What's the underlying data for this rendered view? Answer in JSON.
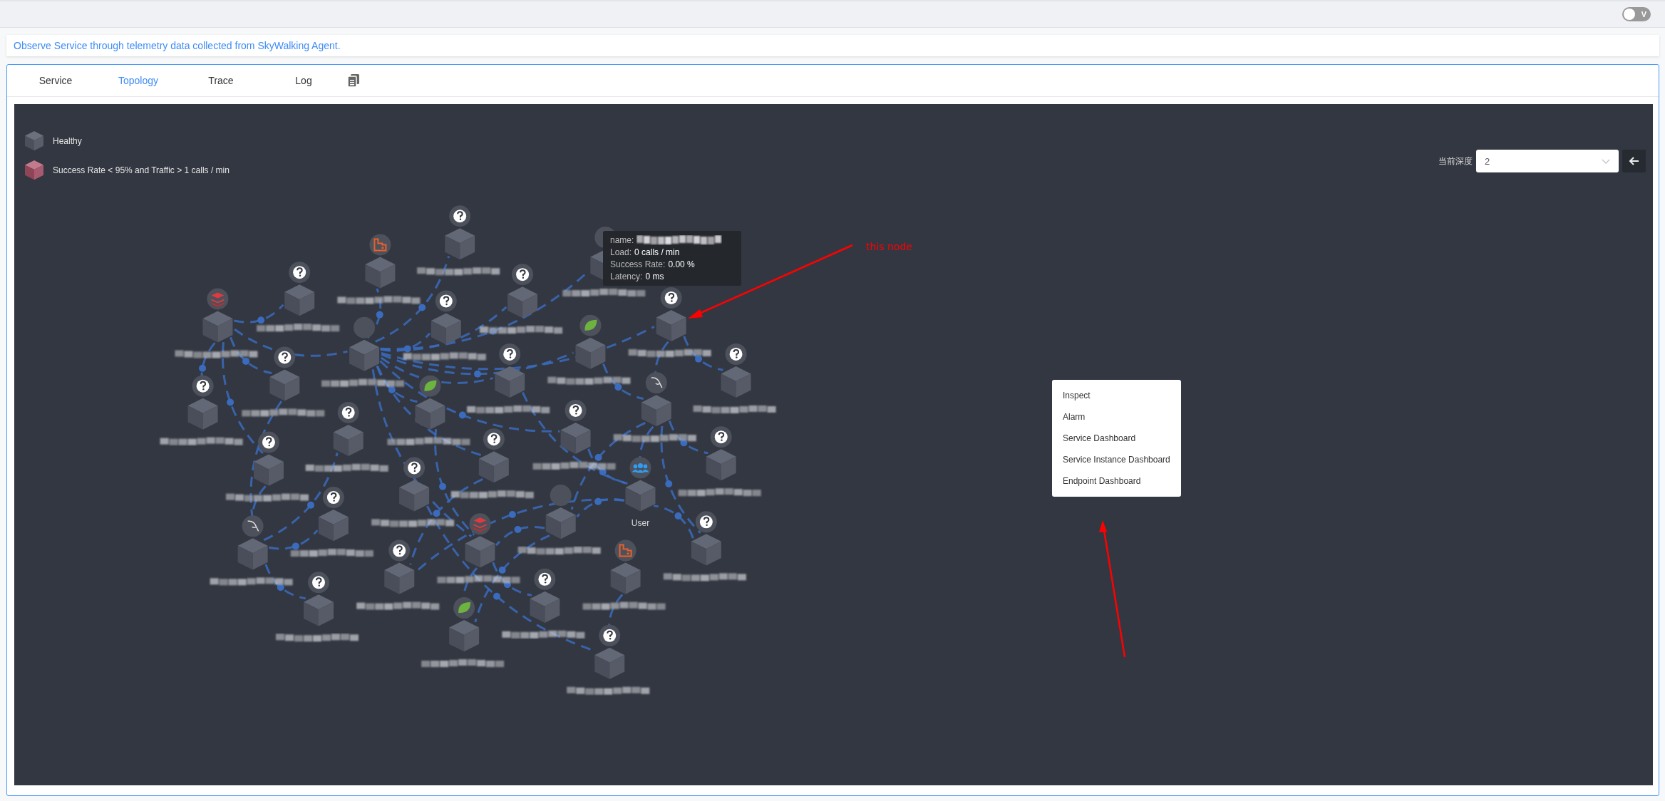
{
  "top_bar": {
    "toggle": {
      "label": "V",
      "on": false
    }
  },
  "description": "Observe Service through telemetry data collected from SkyWalking Agent.",
  "tabs": [
    {
      "label": "Service",
      "selected": false
    },
    {
      "label": "Topology",
      "selected": true
    },
    {
      "label": "Trace",
      "selected": false
    },
    {
      "label": "Log",
      "selected": false
    }
  ],
  "legend": [
    {
      "kind": "healthy",
      "label": "Healthy"
    },
    {
      "kind": "unhealthy",
      "label": "Success Rate < 95% and Traffic > 1 calls / min"
    }
  ],
  "depth": {
    "label": "当前深度",
    "value": "2"
  },
  "nodes": [
    {
      "kind": "unknown"
    },
    {
      "kind": "queue"
    },
    {
      "kind": "unknown"
    },
    {
      "kind": "redis"
    },
    {
      "kind": "unknown"
    },
    {
      "kind": "none"
    },
    {
      "kind": "unknown"
    },
    {
      "kind": "unknown"
    },
    {
      "kind": "none"
    },
    {
      "kind": "spring"
    },
    {
      "kind": "unknown"
    },
    {
      "kind": "unknown"
    },
    {
      "kind": "unknown"
    },
    {
      "kind": "unknown"
    },
    {
      "kind": "spring"
    },
    {
      "kind": "mysql"
    },
    {
      "kind": "unknown"
    },
    {
      "kind": "unknown"
    },
    {
      "kind": "unknown"
    },
    {
      "kind": "unknown"
    },
    {
      "kind": "unknown"
    },
    {
      "kind": "unknown"
    },
    {
      "kind": "user",
      "label": "User"
    },
    {
      "kind": "unknown"
    },
    {
      "kind": "none"
    },
    {
      "kind": "mysql"
    },
    {
      "kind": "redis"
    },
    {
      "kind": "unknown"
    },
    {
      "kind": "unknown"
    },
    {
      "kind": "queue"
    },
    {
      "kind": "unknown"
    },
    {
      "kind": "unknown"
    },
    {
      "kind": "spring"
    },
    {
      "kind": "unknown"
    }
  ],
  "tooltip": {
    "name_label": "name:",
    "rows": [
      {
        "label": "Load:",
        "value": "0 calls / min"
      },
      {
        "label": "Success Rate:",
        "value": "0.00 %"
      },
      {
        "label": "Latency:",
        "value": "0 ms"
      }
    ]
  },
  "context_menu": [
    "Inspect",
    "Alarm",
    "Service Dashboard",
    "Service Instance Dashboard",
    "Endpoint Dashboard"
  ],
  "annotation": {
    "text": "this node"
  }
}
